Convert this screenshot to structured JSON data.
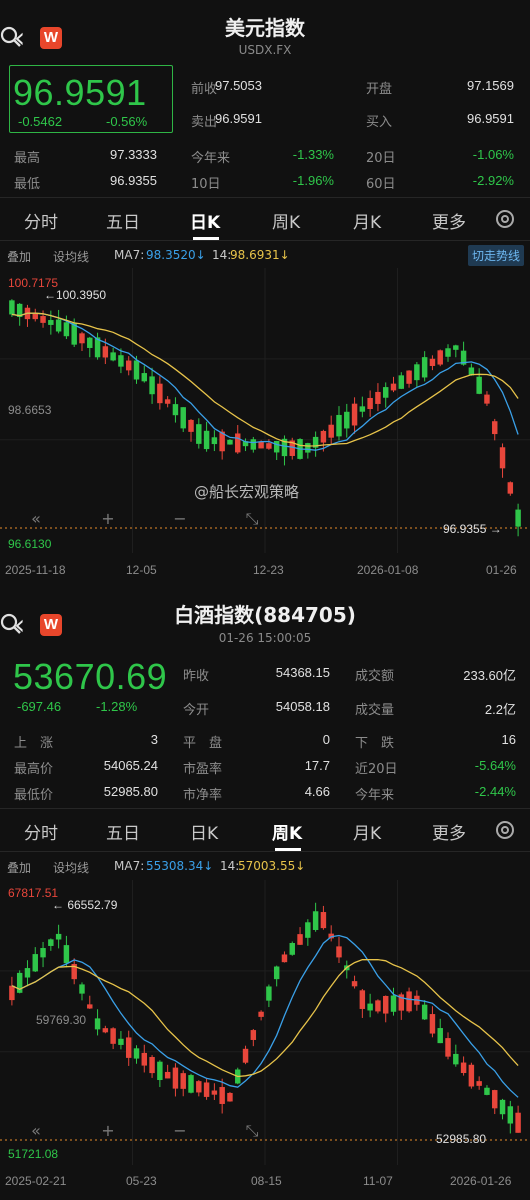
{
  "usd": {
    "title": "美元指数",
    "code": "USDX.FX",
    "price": "96.9591",
    "change": "-0.5462",
    "change_pct": "-0.56%",
    "stats": [
      {
        "label": "前收",
        "value": "97.5053"
      },
      {
        "label": "开盘",
        "value": "97.1569"
      },
      {
        "label": "卖出",
        "value": "96.9591"
      },
      {
        "label": "买入",
        "value": "96.9591"
      },
      {
        "label": "最高",
        "value": "97.3333"
      },
      {
        "label": "今年来",
        "value": "-1.33%"
      },
      {
        "label": "20日",
        "value": "-1.06%"
      },
      {
        "label": "最低",
        "value": "96.9355"
      },
      {
        "label": "10日",
        "value": "-1.96%"
      },
      {
        "label": "60日",
        "value": "-2.92%"
      }
    ],
    "tabs": [
      "分时",
      "五日",
      "日K",
      "周K",
      "月K",
      "更多"
    ],
    "active_tab": "日K",
    "ma": {
      "overlay": "叠加",
      "setting": "设均线",
      "ma7_label": "MA7:",
      "ma7": "98.3520↓",
      "ma14_label": "14:",
      "ma14": "98.6931↓",
      "trend_button": "切走势线"
    },
    "chart_labels": {
      "high": "100.7175",
      "high_marker": "←100.3950",
      "mid": "98.6653",
      "low": "96.6130",
      "low_marker": "96.9355 →"
    },
    "dates": [
      "2025-11-18",
      "12-05",
      "12-23",
      "2026-01-08",
      "01-26"
    ],
    "watermark": "@船长宏观策略"
  },
  "baijiu": {
    "title": "白酒指数(884705)",
    "time": "01-26 15:00:05",
    "price": "53670.69",
    "change": "-697.46",
    "change_pct": "-1.28%",
    "stats": [
      {
        "label": "昨收",
        "value": "54368.15"
      },
      {
        "label": "成交额",
        "value": "233.60亿"
      },
      {
        "label": "今开",
        "value": "54058.18"
      },
      {
        "label": "成交量",
        "value": "2.2亿"
      },
      {
        "label": "上　涨",
        "value": "3"
      },
      {
        "label": "平　盘",
        "value": "0"
      },
      {
        "label": "下　跌",
        "value": "16"
      },
      {
        "label": "最高价",
        "value": "54065.24"
      },
      {
        "label": "市盈率",
        "value": "17.7"
      },
      {
        "label": "近20日",
        "value": "-5.64%"
      },
      {
        "label": "最低价",
        "value": "52985.80"
      },
      {
        "label": "市净率",
        "value": "4.66"
      },
      {
        "label": "今年来",
        "value": "-2.44%"
      }
    ],
    "tabs": [
      "分时",
      "五日",
      "日K",
      "周K",
      "月K",
      "更多"
    ],
    "active_tab": "周K",
    "ma": {
      "overlay": "叠加",
      "setting": "设均线",
      "ma7_label": "MA7:",
      "ma7": "55308.34↓",
      "ma14_label": "14:",
      "ma14": "57003.55↓"
    },
    "chart_labels": {
      "high": "67817.51",
      "high_marker": "← 66552.79",
      "mid": "59769.30",
      "low": "51721.08",
      "low_marker": "52985.80"
    },
    "dates": [
      "2025-02-21",
      "05-23",
      "08-15",
      "11-07",
      "2026-01-26"
    ]
  },
  "colors": {
    "up": "#e8463b",
    "down": "#2fc64a",
    "ma7": "#3aa0e8",
    "ma14": "#e7c34a",
    "bg": "#111111"
  }
}
